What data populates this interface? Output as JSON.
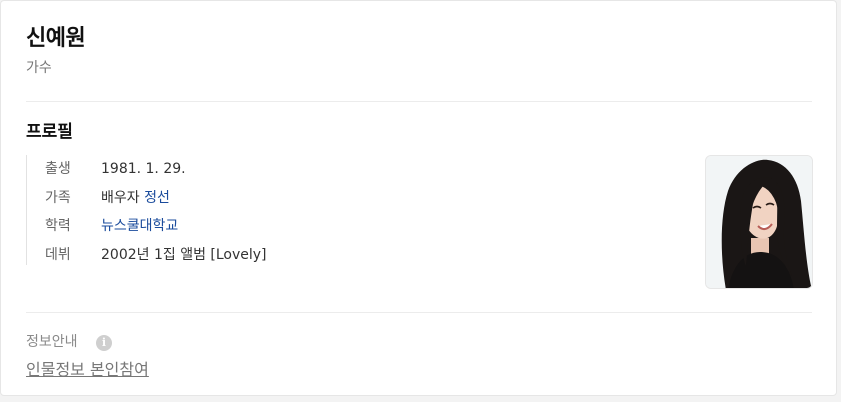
{
  "person": {
    "name": "신예원",
    "occupation": "가수"
  },
  "profile": {
    "section_title": "프로필",
    "rows": [
      {
        "label": "출생",
        "value": "1981. 1. 29."
      },
      {
        "label": "가족",
        "prefix": "배우자",
        "link": "정선"
      },
      {
        "label": "학력",
        "link": "뉴스쿨대학교"
      },
      {
        "label": "데뷔",
        "value": "2002년 1집 앨범 [Lovely]"
      }
    ]
  },
  "photo": {
    "icon": "person-photo"
  },
  "info": {
    "label": "정보안내",
    "icon_glyph": "i",
    "participate_link": "인물정보 본인참여"
  },
  "colors": {
    "link": "#1a4b9c",
    "muted": "#767676"
  }
}
